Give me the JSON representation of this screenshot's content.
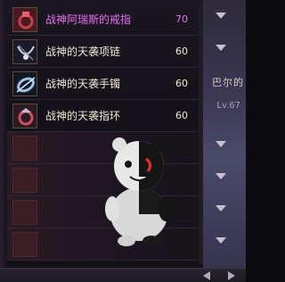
{
  "items": [
    {
      "name": "战神阿瑞斯的戒指",
      "level": "70",
      "icon": "ring-icon",
      "special": true
    },
    {
      "name": "战神的天袭项链",
      "level": "60",
      "icon": "necklace-icon",
      "special": false
    },
    {
      "name": "战神的天袭手镯",
      "level": "60",
      "icon": "bracelet-icon",
      "special": false
    },
    {
      "name": "战神的天袭指环",
      "level": "60",
      "icon": "ring-icon",
      "special": false
    }
  ],
  "background": {
    "right_text": "巴尔的",
    "right_label": "Lv.67"
  },
  "colors": {
    "special_name": "#e870f0",
    "normal_name": "#f0e8d8"
  }
}
